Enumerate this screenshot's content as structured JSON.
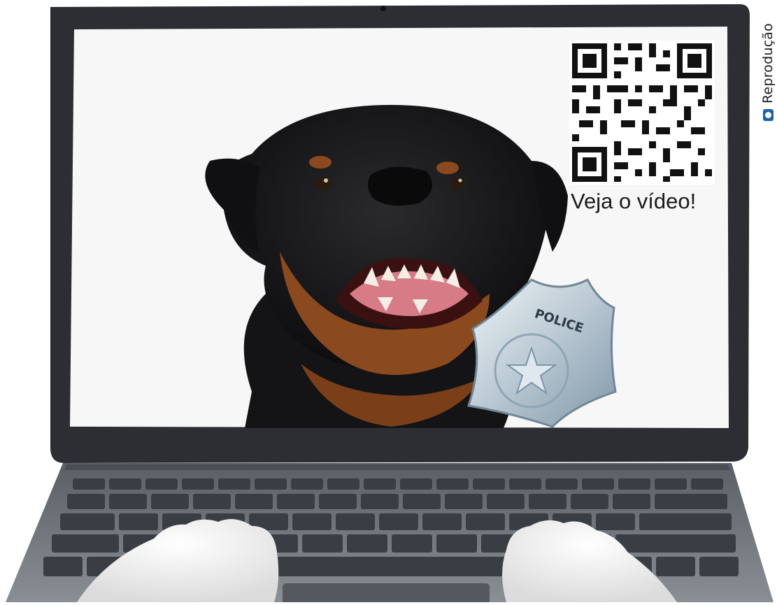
{
  "credit": {
    "label": "Reprodução",
    "icon": "camera-icon"
  },
  "qr": {
    "caption": "Veja o vídeo!",
    "icon": "qr-code"
  },
  "badge": {
    "text": "POLICE"
  },
  "colors": {
    "laptop_body": "#2c2e33",
    "screen_bg": "#f7f7f7",
    "keyboard_deck": "#6b6f76",
    "key": "#3a3d44",
    "badge_silver": "#c9d6de",
    "credit_icon": "#1a63a8"
  }
}
